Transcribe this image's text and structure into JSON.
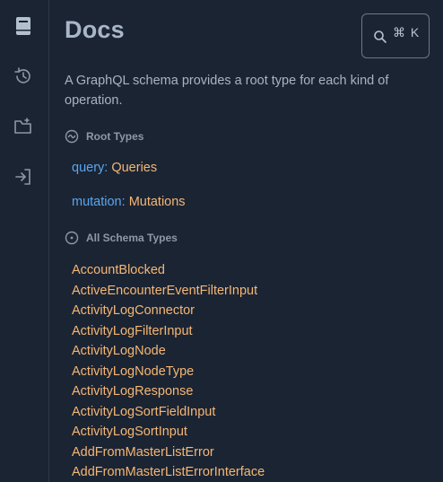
{
  "sidebar": {
    "items": [
      {
        "name": "docs",
        "icon": "book-icon"
      },
      {
        "name": "history",
        "icon": "history-icon"
      },
      {
        "name": "collections",
        "icon": "folder-add-icon"
      },
      {
        "name": "login",
        "icon": "login-icon"
      }
    ]
  },
  "header": {
    "title": "Docs",
    "search_shortcut": "⌘ K"
  },
  "description": "A GraphQL schema provides a root type for each kind of operation.",
  "root_types": {
    "heading": "Root Types",
    "items": [
      {
        "field": "query",
        "type": "Queries"
      },
      {
        "field": "mutation",
        "type": "Mutations"
      }
    ]
  },
  "all_types": {
    "heading": "All Schema Types",
    "items": [
      "AccountBlocked",
      "ActiveEncounterEventFilterInput",
      "ActivityLogConnector",
      "ActivityLogFilterInput",
      "ActivityLogNode",
      "ActivityLogNodeType",
      "ActivityLogResponse",
      "ActivityLogSortFieldInput",
      "ActivityLogSortInput",
      "AddFromMasterListError",
      "AddFromMasterListErrorInterface"
    ]
  },
  "colors": {
    "background": "#1b2433",
    "field": "#5aa6f0",
    "type": "#f5b774",
    "title": "#a9b6c8"
  }
}
